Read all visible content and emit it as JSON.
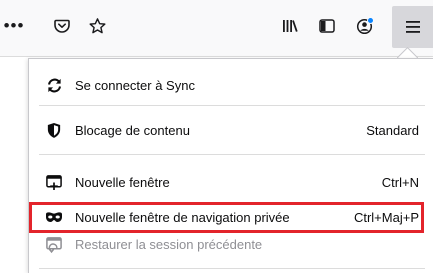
{
  "toolbar": {
    "overflow_glyph": "•••",
    "icons": [
      "overflow-icon",
      "pocket-icon",
      "star-icon",
      "library-icon",
      "sidebar-icon",
      "account-icon",
      "hamburger-menu-icon"
    ]
  },
  "menu": {
    "sync": {
      "label": "Se connecter à Sync",
      "icon": "sync-icon"
    },
    "content_blocking": {
      "label": "Blocage de contenu",
      "value": "Standard",
      "icon": "shield-icon"
    },
    "new_window": {
      "label": "Nouvelle fenêtre",
      "shortcut": "Ctrl+N",
      "icon": "new-window-icon"
    },
    "private_window": {
      "label": "Nouvelle fenêtre de navigation privée",
      "shortcut": "Ctrl+Maj+P",
      "icon": "private-mask-icon"
    },
    "restore_session": {
      "label": "Restaurer la session précédente",
      "icon": "restore-session-icon",
      "disabled": true
    }
  },
  "colors": {
    "highlight": "#e3242b",
    "menu_button_active": "#d7d7db",
    "account_dot": "#0a84ff"
  }
}
